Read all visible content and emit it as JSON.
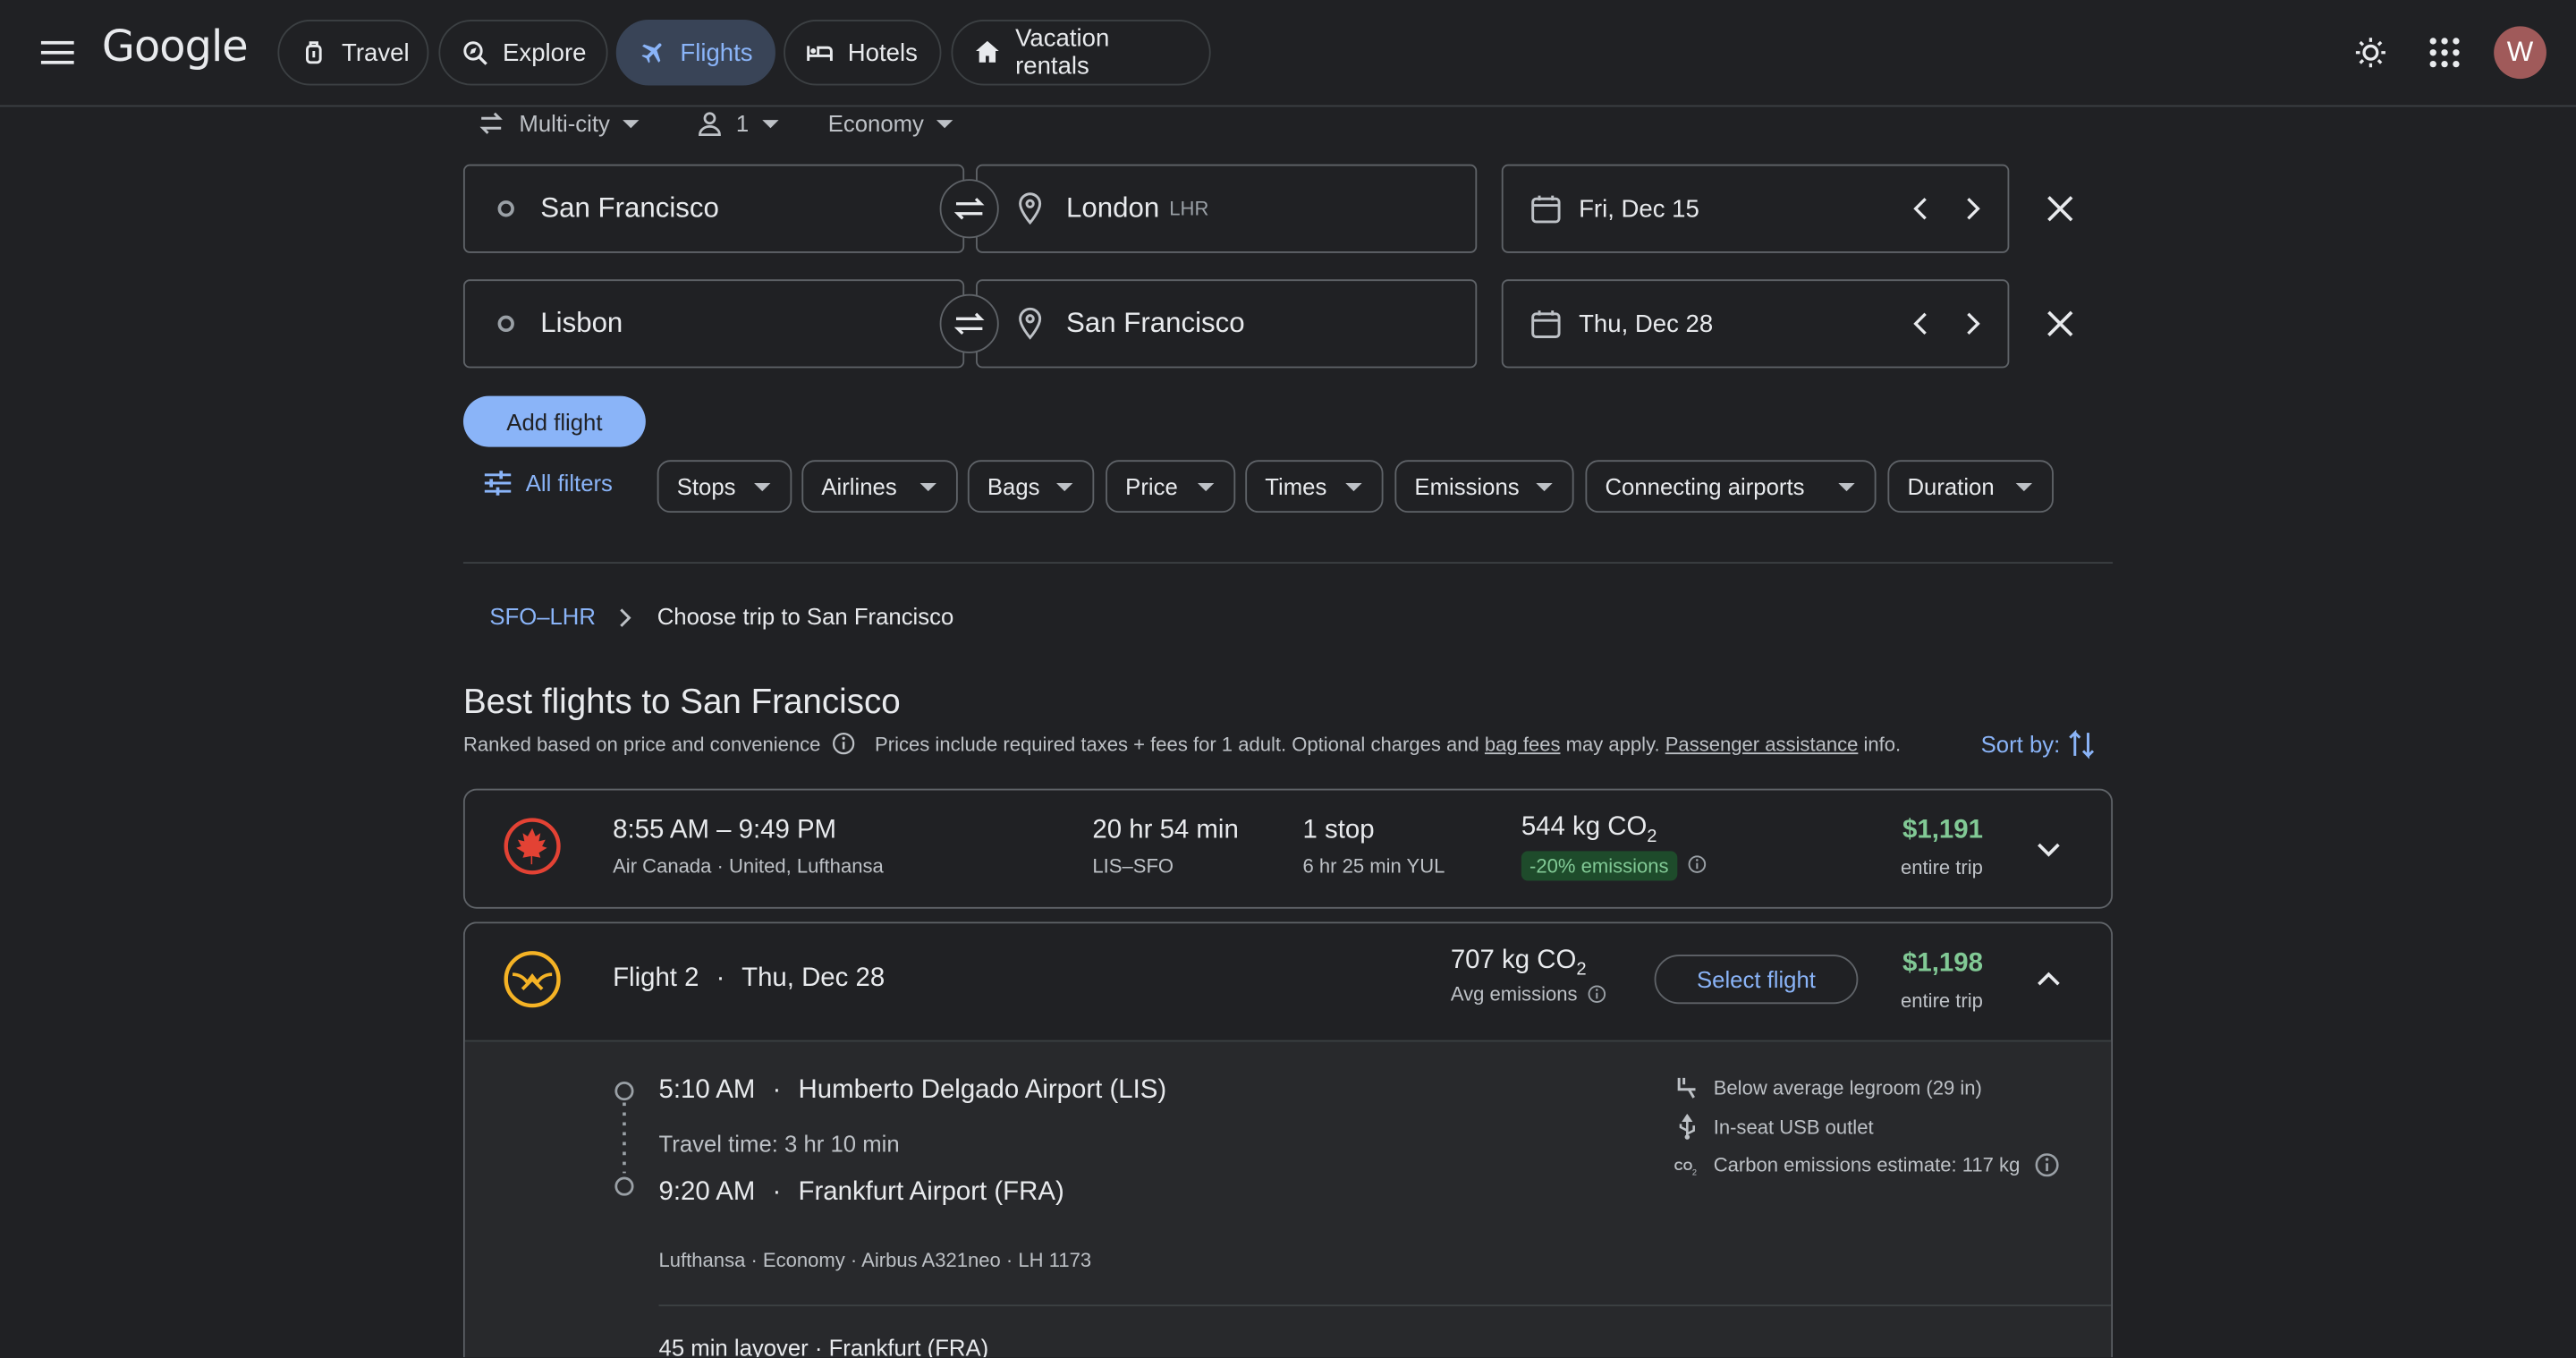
{
  "header": {
    "logo": "Google",
    "tabs": [
      {
        "label": "Travel",
        "icon": "luggage-icon"
      },
      {
        "label": "Explore",
        "icon": "explore-icon"
      },
      {
        "label": "Flights",
        "icon": "airplane-icon",
        "active": true
      },
      {
        "label": "Hotels",
        "icon": "bed-icon"
      },
      {
        "label": "Vacation rentals",
        "icon": "house-icon"
      }
    ],
    "avatar_letter": "W"
  },
  "trip_options": {
    "trip_type": "Multi-city",
    "passengers": "1",
    "cabin": "Economy"
  },
  "legs": [
    {
      "from": "San Francisco",
      "to": "London",
      "to_code": "LHR",
      "date": "Fri, Dec 15"
    },
    {
      "from": "Lisbon",
      "to": "San Francisco",
      "to_code": "",
      "date": "Thu, Dec 28"
    }
  ],
  "add_flight_label": "Add flight",
  "filters": {
    "all_filters_label": "All filters",
    "chips": [
      "Stops",
      "Airlines",
      "Bags",
      "Price",
      "Times",
      "Emissions",
      "Connecting airports",
      "Duration"
    ]
  },
  "breadcrumb": {
    "first": "SFO–LHR",
    "current": "Choose trip to San Francisco"
  },
  "results": {
    "title": "Best flights to San Francisco",
    "ranked_text": "Ranked based on price and convenience",
    "prices_text_1": "Prices include required taxes + fees for 1 adult. Optional charges and",
    "bag_fees_link": "bag fees",
    "prices_text_2": "may apply.",
    "passenger_link": "Passenger assistance",
    "prices_text_3": "info.",
    "sort_label": "Sort by:"
  },
  "flight1": {
    "times": "8:55 AM – 9:49 PM",
    "airlines": "Air Canada · United, Lufthansa",
    "duration": "20 hr 54 min",
    "route": "LIS–SFO",
    "stops": "1 stop",
    "stop_detail": "6 hr 25 min YUL",
    "emissions": "544 kg CO",
    "emissions_sub": "2",
    "emissions_badge": "-20% emissions",
    "price": "$1,191",
    "price_label": "entire trip",
    "brand_color": "#e34234"
  },
  "flight2": {
    "title": "Flight 2",
    "date": "Thu, Dec 28",
    "emissions": "707 kg CO",
    "emissions_sub": "2",
    "emissions_label": "Avg emissions",
    "select_label": "Select flight",
    "price": "$1,198",
    "price_label": "entire trip",
    "brand_color": "#f5b325",
    "segment": {
      "depart_time": "5:10 AM",
      "depart_airport": "Humberto Delgado Airport (LIS)",
      "travel_time": "Travel time: 3 hr 10 min",
      "arrive_time": "9:20 AM",
      "arrive_airport": "Frankfurt Airport (FRA)",
      "info": "Lufthansa · Economy · Airbus A321neo · LH 1173",
      "amenities": [
        {
          "icon": "legroom-icon",
          "text": "Below average legroom (29 in)"
        },
        {
          "icon": "usb-icon",
          "text": "In-seat USB outlet"
        },
        {
          "icon": "co2-icon",
          "text": "Carbon emissions estimate: 117 kg"
        }
      ]
    },
    "layover": "45 min layover · Frankfurt (FRA)"
  }
}
